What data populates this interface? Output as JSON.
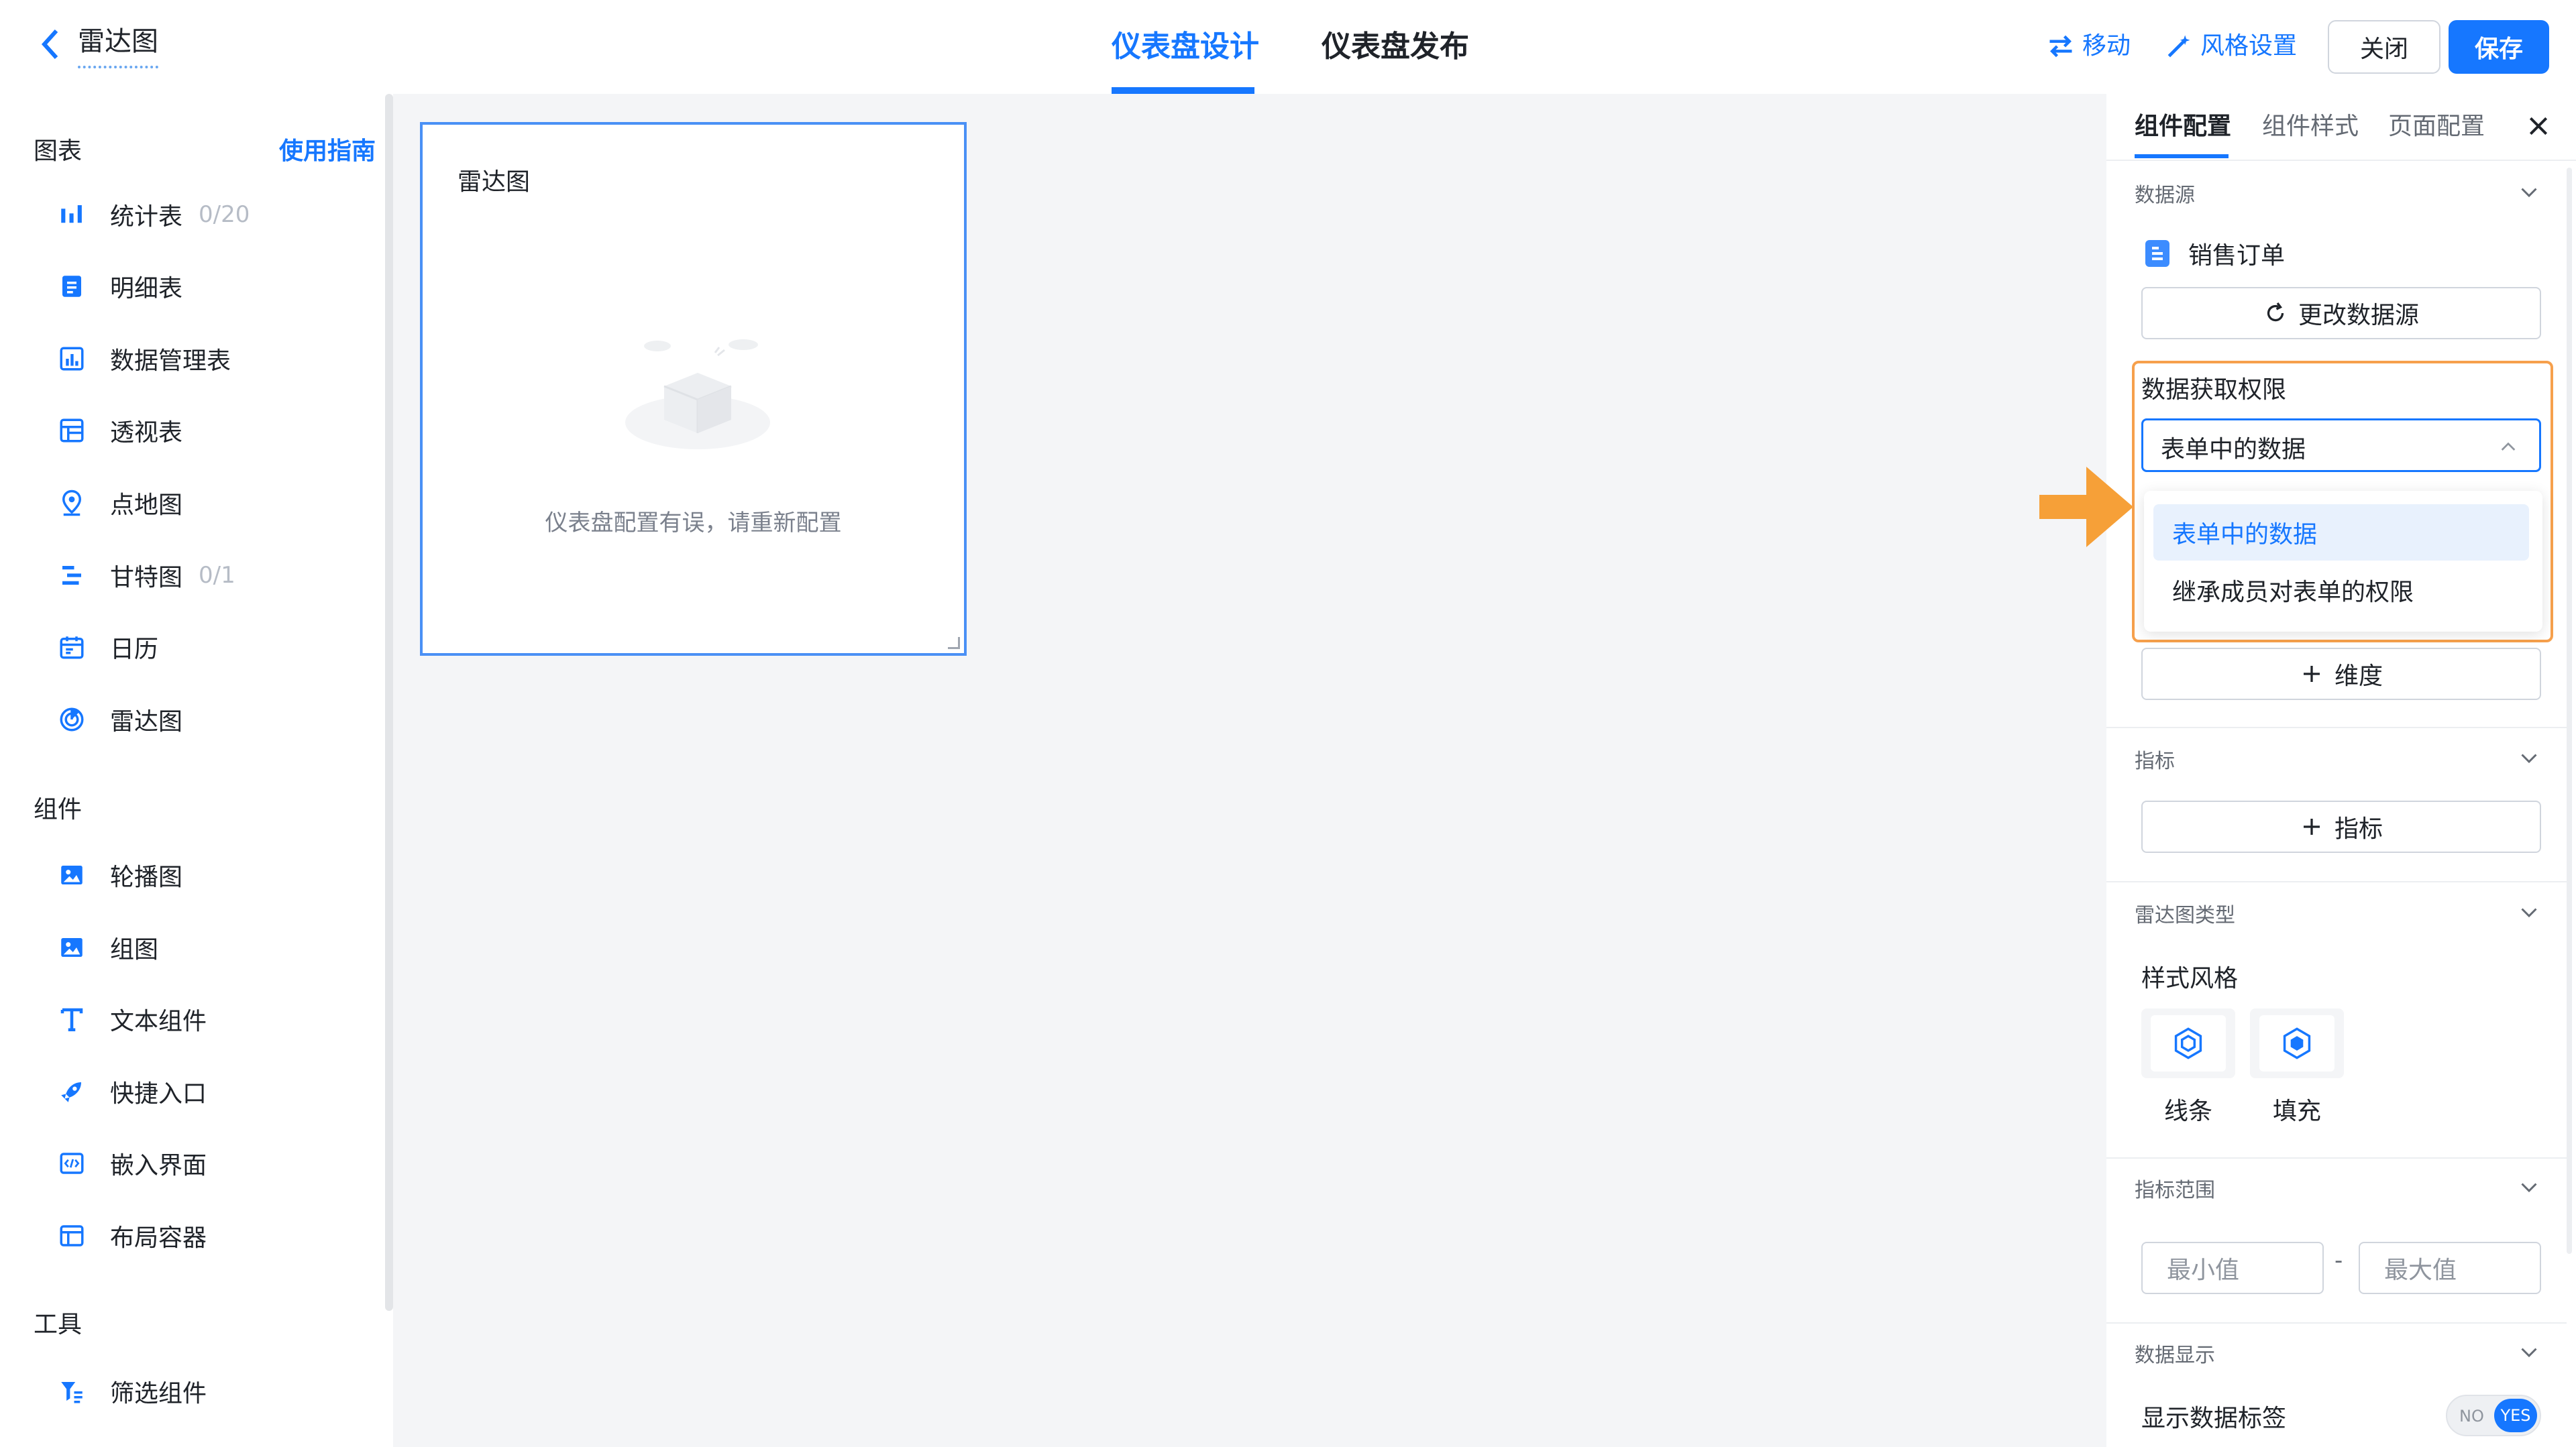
{
  "header": {
    "page_name": "雷达图",
    "tabs": [
      {
        "label": "仪表盘设计"
      },
      {
        "label": "仪表盘发布"
      }
    ],
    "move_label": "移动",
    "style_settings_label": "风格设置",
    "close_label": "关闭",
    "save_label": "保存"
  },
  "sidebar": {
    "sections": {
      "charts": "图表",
      "components": "组件",
      "tools": "工具"
    },
    "guide_link": "使用指南",
    "charts": [
      {
        "label": "统计表",
        "count": "0/20",
        "icon": "bar-chart-icon"
      },
      {
        "label": "明细表",
        "icon": "list-doc-icon"
      },
      {
        "label": "数据管理表",
        "icon": "data-table-icon"
      },
      {
        "label": "透视表",
        "icon": "pivot-table-icon"
      },
      {
        "label": "点地图",
        "icon": "map-pin-icon"
      },
      {
        "label": "甘特图",
        "count": "0/1",
        "icon": "gantt-icon"
      },
      {
        "label": "日历",
        "icon": "calendar-icon"
      },
      {
        "label": "雷达图",
        "icon": "radar-icon"
      }
    ],
    "components": [
      {
        "label": "轮播图",
        "icon": "image-icon"
      },
      {
        "label": "组图",
        "icon": "image-group-icon"
      },
      {
        "label": "文本组件",
        "icon": "text-icon"
      },
      {
        "label": "快捷入口",
        "icon": "rocket-icon"
      },
      {
        "label": "嵌入界面",
        "icon": "code-icon"
      },
      {
        "label": "布局容器",
        "icon": "layout-icon"
      }
    ],
    "tools": [
      {
        "label": "筛选组件",
        "icon": "filter-icon"
      }
    ]
  },
  "canvas": {
    "card_title": "雷达图",
    "card_message": "仪表盘配置有误，请重新配置"
  },
  "panel": {
    "tabs": [
      "组件配置",
      "组件样式",
      "页面配置"
    ],
    "data_source": {
      "title": "数据源",
      "name": "销售订单",
      "change_label": "更改数据源"
    },
    "permission": {
      "title": "数据获取权限",
      "selected": "表单中的数据",
      "options": [
        "表单中的数据",
        "继承成员对表单的权限"
      ]
    },
    "dimension_button": "维度",
    "metric": {
      "title": "指标",
      "add_label": "指标"
    },
    "radar_type": {
      "title": "雷达图类型",
      "style_label": "样式风格",
      "options": [
        "线条",
        "填充"
      ]
    },
    "metric_range": {
      "title": "指标范围",
      "min_placeholder": "最小值",
      "max_placeholder": "最大值",
      "dash": "-"
    },
    "data_display": {
      "title": "数据显示",
      "show_labels": "显示数据标签",
      "toggle_off": "NO",
      "toggle_on": "YES"
    }
  },
  "colors": {
    "accent": "#1677ff",
    "annotation": "#f6a04c",
    "canvas_bg": "#f4f5f7"
  }
}
